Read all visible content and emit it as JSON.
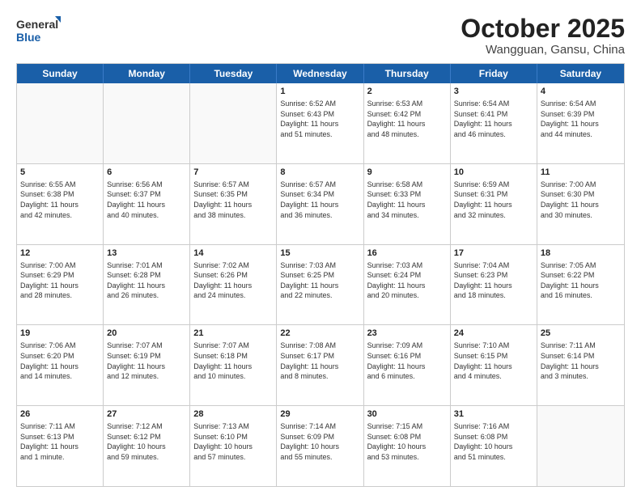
{
  "logo": {
    "line1": "General",
    "line2": "Blue"
  },
  "title": "October 2025",
  "subtitle": "Wangguan, Gansu, China",
  "days": [
    "Sunday",
    "Monday",
    "Tuesday",
    "Wednesday",
    "Thursday",
    "Friday",
    "Saturday"
  ],
  "weeks": [
    [
      {
        "day": "",
        "info": ""
      },
      {
        "day": "",
        "info": ""
      },
      {
        "day": "",
        "info": ""
      },
      {
        "day": "1",
        "info": "Sunrise: 6:52 AM\nSunset: 6:43 PM\nDaylight: 11 hours\nand 51 minutes."
      },
      {
        "day": "2",
        "info": "Sunrise: 6:53 AM\nSunset: 6:42 PM\nDaylight: 11 hours\nand 48 minutes."
      },
      {
        "day": "3",
        "info": "Sunrise: 6:54 AM\nSunset: 6:41 PM\nDaylight: 11 hours\nand 46 minutes."
      },
      {
        "day": "4",
        "info": "Sunrise: 6:54 AM\nSunset: 6:39 PM\nDaylight: 11 hours\nand 44 minutes."
      }
    ],
    [
      {
        "day": "5",
        "info": "Sunrise: 6:55 AM\nSunset: 6:38 PM\nDaylight: 11 hours\nand 42 minutes."
      },
      {
        "day": "6",
        "info": "Sunrise: 6:56 AM\nSunset: 6:37 PM\nDaylight: 11 hours\nand 40 minutes."
      },
      {
        "day": "7",
        "info": "Sunrise: 6:57 AM\nSunset: 6:35 PM\nDaylight: 11 hours\nand 38 minutes."
      },
      {
        "day": "8",
        "info": "Sunrise: 6:57 AM\nSunset: 6:34 PM\nDaylight: 11 hours\nand 36 minutes."
      },
      {
        "day": "9",
        "info": "Sunrise: 6:58 AM\nSunset: 6:33 PM\nDaylight: 11 hours\nand 34 minutes."
      },
      {
        "day": "10",
        "info": "Sunrise: 6:59 AM\nSunset: 6:31 PM\nDaylight: 11 hours\nand 32 minutes."
      },
      {
        "day": "11",
        "info": "Sunrise: 7:00 AM\nSunset: 6:30 PM\nDaylight: 11 hours\nand 30 minutes."
      }
    ],
    [
      {
        "day": "12",
        "info": "Sunrise: 7:00 AM\nSunset: 6:29 PM\nDaylight: 11 hours\nand 28 minutes."
      },
      {
        "day": "13",
        "info": "Sunrise: 7:01 AM\nSunset: 6:28 PM\nDaylight: 11 hours\nand 26 minutes."
      },
      {
        "day": "14",
        "info": "Sunrise: 7:02 AM\nSunset: 6:26 PM\nDaylight: 11 hours\nand 24 minutes."
      },
      {
        "day": "15",
        "info": "Sunrise: 7:03 AM\nSunset: 6:25 PM\nDaylight: 11 hours\nand 22 minutes."
      },
      {
        "day": "16",
        "info": "Sunrise: 7:03 AM\nSunset: 6:24 PM\nDaylight: 11 hours\nand 20 minutes."
      },
      {
        "day": "17",
        "info": "Sunrise: 7:04 AM\nSunset: 6:23 PM\nDaylight: 11 hours\nand 18 minutes."
      },
      {
        "day": "18",
        "info": "Sunrise: 7:05 AM\nSunset: 6:22 PM\nDaylight: 11 hours\nand 16 minutes."
      }
    ],
    [
      {
        "day": "19",
        "info": "Sunrise: 7:06 AM\nSunset: 6:20 PM\nDaylight: 11 hours\nand 14 minutes."
      },
      {
        "day": "20",
        "info": "Sunrise: 7:07 AM\nSunset: 6:19 PM\nDaylight: 11 hours\nand 12 minutes."
      },
      {
        "day": "21",
        "info": "Sunrise: 7:07 AM\nSunset: 6:18 PM\nDaylight: 11 hours\nand 10 minutes."
      },
      {
        "day": "22",
        "info": "Sunrise: 7:08 AM\nSunset: 6:17 PM\nDaylight: 11 hours\nand 8 minutes."
      },
      {
        "day": "23",
        "info": "Sunrise: 7:09 AM\nSunset: 6:16 PM\nDaylight: 11 hours\nand 6 minutes."
      },
      {
        "day": "24",
        "info": "Sunrise: 7:10 AM\nSunset: 6:15 PM\nDaylight: 11 hours\nand 4 minutes."
      },
      {
        "day": "25",
        "info": "Sunrise: 7:11 AM\nSunset: 6:14 PM\nDaylight: 11 hours\nand 3 minutes."
      }
    ],
    [
      {
        "day": "26",
        "info": "Sunrise: 7:11 AM\nSunset: 6:13 PM\nDaylight: 11 hours\nand 1 minute."
      },
      {
        "day": "27",
        "info": "Sunrise: 7:12 AM\nSunset: 6:12 PM\nDaylight: 10 hours\nand 59 minutes."
      },
      {
        "day": "28",
        "info": "Sunrise: 7:13 AM\nSunset: 6:10 PM\nDaylight: 10 hours\nand 57 minutes."
      },
      {
        "day": "29",
        "info": "Sunrise: 7:14 AM\nSunset: 6:09 PM\nDaylight: 10 hours\nand 55 minutes."
      },
      {
        "day": "30",
        "info": "Sunrise: 7:15 AM\nSunset: 6:08 PM\nDaylight: 10 hours\nand 53 minutes."
      },
      {
        "day": "31",
        "info": "Sunrise: 7:16 AM\nSunset: 6:08 PM\nDaylight: 10 hours\nand 51 minutes."
      },
      {
        "day": "",
        "info": ""
      }
    ]
  ]
}
